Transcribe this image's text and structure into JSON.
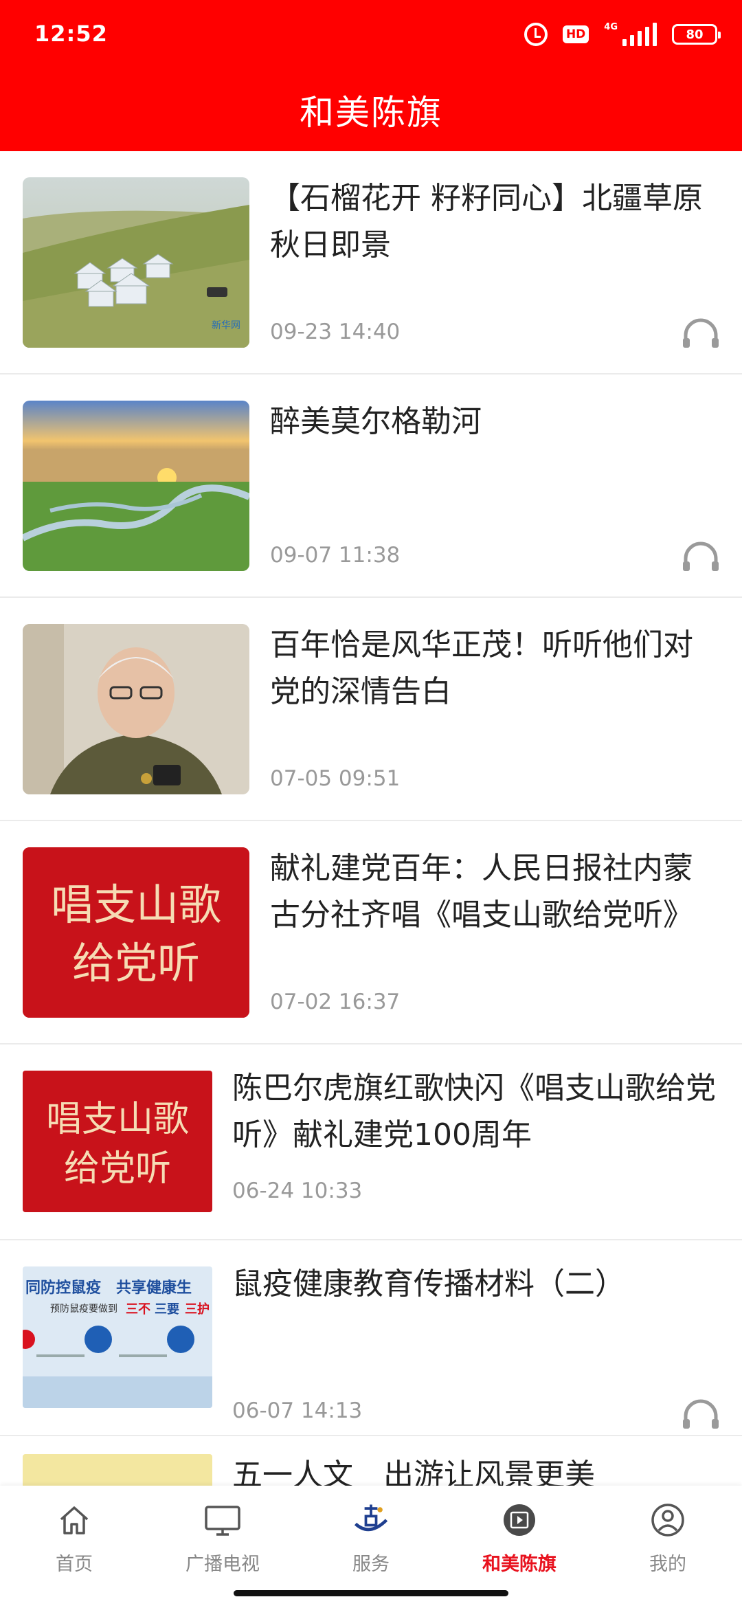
{
  "status_bar": {
    "time": "12:52",
    "hd_label": "HD",
    "network_label": "4G",
    "battery": "80"
  },
  "header": {
    "title": "和美陈旗"
  },
  "articles": [
    {
      "title": "【石榴花开 籽籽同心】北疆草原秋日即景",
      "time": "09-23 14:40",
      "audio": true,
      "image_caption": "新华网"
    },
    {
      "title": "醉美莫尔格勒河",
      "time": "09-07 11:38",
      "audio": true
    },
    {
      "title": "百年恰是风华正茂！听听他们对党的深情告白",
      "time": "07-05 09:51",
      "audio": false
    },
    {
      "title": "献礼建党百年：人民日报社内蒙古分社齐唱《唱支山歌给党听》",
      "time": "07-02 16:37",
      "audio": false,
      "image_text": [
        "唱支山歌",
        "给党听"
      ]
    },
    {
      "title": "陈巴尔虎旗红歌快闪《唱支山歌给党听》献礼建党100周年",
      "time": "06-24 10:33",
      "audio": false,
      "image_text": [
        "唱支山歌",
        "给党听"
      ]
    },
    {
      "title": "鼠疫健康教育传播材料（二）",
      "time": "06-07 14:13",
      "audio": true,
      "image_text": [
        "同防控鼠疫　共享健康生",
        "预防鼠疫要做到",
        "三不",
        "三要",
        "三护"
      ]
    },
    {
      "title": "五一人文　出游让风景更美"
    }
  ],
  "tabbar": {
    "tabs": [
      {
        "label": "首页",
        "icon": "home-icon"
      },
      {
        "label": "广播电视",
        "icon": "tv-icon"
      },
      {
        "label": "服务",
        "icon": "service-logo-icon"
      },
      {
        "label": "和美陈旗",
        "icon": "video-icon",
        "active": true
      },
      {
        "label": "我的",
        "icon": "profile-icon"
      }
    ]
  },
  "colors": {
    "brand_red": "#ff0000",
    "active_tab": "#e8121e",
    "meta_gray": "#999999"
  }
}
